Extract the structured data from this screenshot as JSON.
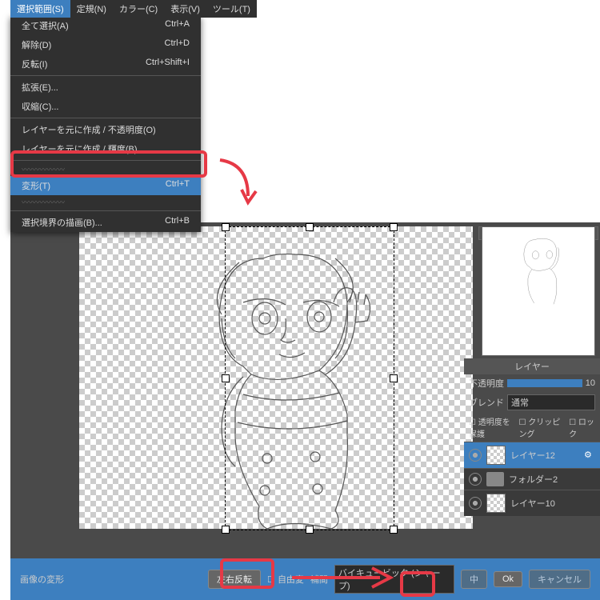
{
  "menubar": {
    "items": [
      "選択範囲(S)",
      "定規(N)",
      "カラー(C)",
      "表示(V)",
      "ツール(T)"
    ]
  },
  "dropdown": [
    {
      "t": "item",
      "label": "全て選択(A)",
      "sc": "Ctrl+A"
    },
    {
      "t": "item",
      "label": "解除(D)",
      "sc": "Ctrl+D"
    },
    {
      "t": "item",
      "label": "反転(I)",
      "sc": "Ctrl+Shift+I"
    },
    {
      "t": "sep"
    },
    {
      "t": "item",
      "label": "拡張(E)..."
    },
    {
      "t": "item",
      "label": "収縮(C)..."
    },
    {
      "t": "sep"
    },
    {
      "t": "item",
      "label": "レイヤーを元に作成 / 不透明度(O)"
    },
    {
      "t": "item",
      "label": "レイヤーを元に作成 / 輝度(B)"
    },
    {
      "t": "sep"
    },
    {
      "t": "squig"
    },
    {
      "t": "item",
      "label": "変形(T)",
      "sc": "Ctrl+T",
      "hl": true
    },
    {
      "t": "squig"
    },
    {
      "t": "sep"
    },
    {
      "t": "item",
      "label": "選択境界の描画(B)...",
      "sc": "Ctrl+B"
    }
  ],
  "panel": {
    "title": "レイヤー",
    "opacity_label": "不透明度",
    "opacity_value": "10",
    "blend_label": "ブレンド",
    "blend_value": "通常",
    "cks": [
      "透明度を保護",
      "クリッピング",
      "ロック"
    ],
    "layers": [
      {
        "name": "レイヤー12",
        "sel": true,
        "type": "img"
      },
      {
        "name": "フォルダー2",
        "type": "folder"
      },
      {
        "name": "レイヤー10",
        "type": "img"
      }
    ]
  },
  "bbar": {
    "title": "画像の変形",
    "flip": "左右反転",
    "free": "自由変",
    "interp_label": "補間",
    "interp": "バイキュービック (シャープ)",
    "apply": "中",
    "ok": "Ok",
    "cancel": "キャンセル"
  }
}
